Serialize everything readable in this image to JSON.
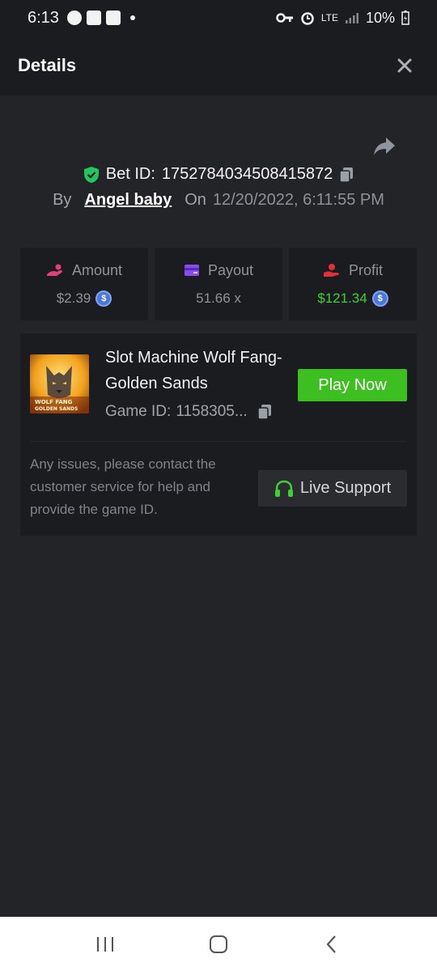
{
  "status_bar": {
    "time": "6:13",
    "network": "LTE",
    "battery": "10%"
  },
  "header": {
    "title": "Details",
    "close_icon": "close-icon"
  },
  "bet": {
    "label": "Bet ID:",
    "id": "1752784034508415872",
    "by_label": "By",
    "user": "Angel baby",
    "on_label": "On",
    "date": "12/20/2022, 6:11:55 PM"
  },
  "stats": {
    "amount": {
      "label": "Amount",
      "value": "$2.39",
      "icon": "bet-hand-icon",
      "color": "#e0407a"
    },
    "payout": {
      "label": "Payout",
      "value": "51.66 x",
      "icon": "card-icon",
      "color": "#8a4cf0"
    },
    "profit": {
      "label": "Profit",
      "value": "$121.34",
      "icon": "money-hand-icon",
      "color": "#e0303a"
    }
  },
  "game": {
    "name": "Slot Machine Wolf Fang- Golden Sands",
    "id_label": "Game ID:",
    "id": "1158305...",
    "play_label": "Play Now",
    "thumb_line1": "WOLF FANG",
    "thumb_line2": "GOLDEN SANDS"
  },
  "support": {
    "text": "Any issues, please contact the customer service for help and provide the game ID.",
    "button_label": "Live Support"
  },
  "colors": {
    "accent_green": "#3dbf22",
    "profit_green": "#3fcf3a",
    "background": "#232428",
    "card": "#1b1c1f"
  }
}
